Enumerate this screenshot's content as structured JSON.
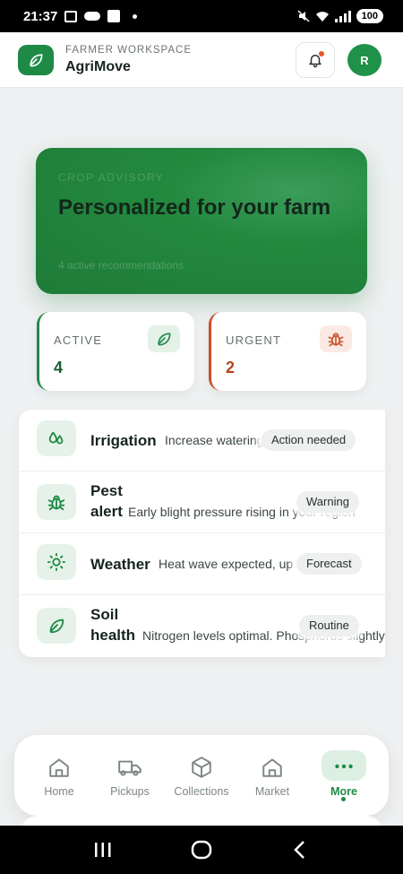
{
  "status_bar": {
    "time": "21:37",
    "battery": "100"
  },
  "header": {
    "workspace_label": "FARMER WORKSPACE",
    "app_name": "AgriMove",
    "avatar_initial": "R",
    "logo_icon": "leaf-icon",
    "notification_icon": "bell-icon"
  },
  "hero": {
    "kicker": "CROP ADVISORY",
    "title": "Personalized for your farm",
    "subtitle": "4 active recommendations"
  },
  "stats": {
    "active": {
      "label": "ACTIVE",
      "value": "4",
      "icon": "leaf-icon"
    },
    "urgent": {
      "label": "URGENT",
      "value": "2",
      "icon": "bug-icon"
    }
  },
  "recommendations": [
    {
      "title": "Irrigation",
      "description": "Increase watering next week",
      "badge": "Action needed",
      "icon": "droplets-icon"
    },
    {
      "title": "Pest alert",
      "description": "Early blight pressure rising in your region",
      "badge": "Warning",
      "icon": "bug-icon"
    },
    {
      "title": "Weather",
      "description": "Heat wave expected, up to 38C",
      "badge": "Forecast",
      "icon": "sun-icon"
    },
    {
      "title": "Soil health",
      "description": "Nitrogen levels optimal. Phosphorus slightly low",
      "badge": "Routine",
      "icon": "leaf-icon"
    }
  ],
  "nav": {
    "items": [
      {
        "label": "Home",
        "icon": "home-icon"
      },
      {
        "label": "Pickups",
        "icon": "truck-icon"
      },
      {
        "label": "Collections",
        "icon": "box-icon"
      },
      {
        "label": "Market",
        "icon": "store-icon"
      },
      {
        "label": "More",
        "icon": "more-dots-icon"
      }
    ],
    "selected": "More"
  },
  "colors": {
    "brand_green": "#1f8a45",
    "urgent_orange": "#c8502a",
    "background": "#eef0f1"
  }
}
